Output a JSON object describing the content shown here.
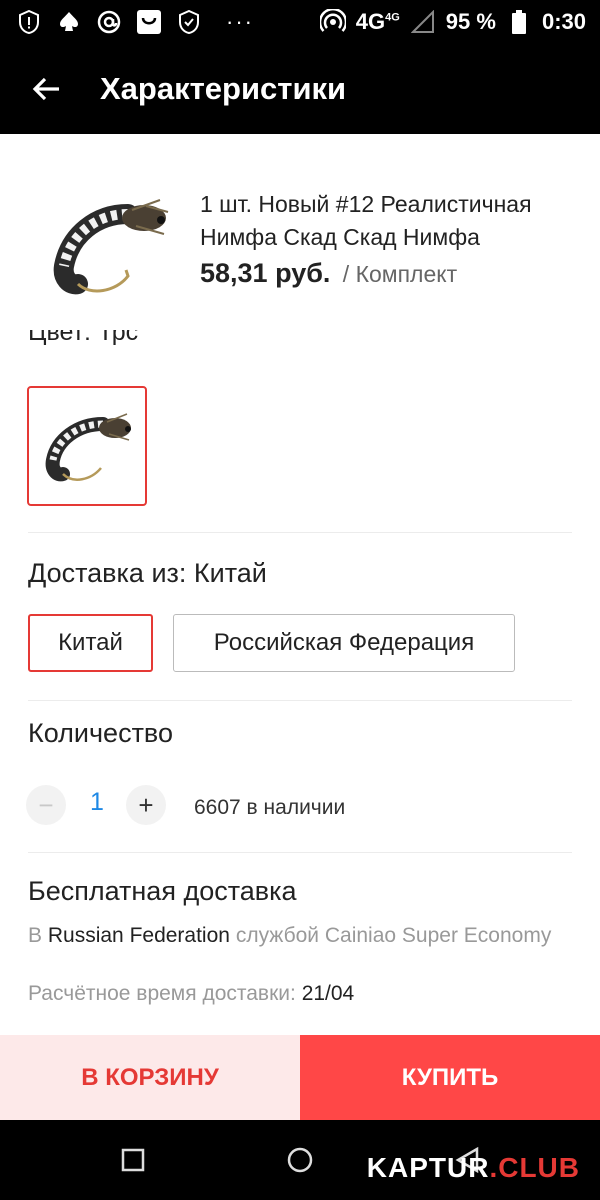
{
  "status_bar": {
    "network": "4G",
    "network_sup": "4G",
    "battery": "95 %",
    "time": "0:30",
    "more": "···"
  },
  "app_bar": {
    "title": "Характеристики"
  },
  "product": {
    "title": "1 шт. Новый #12 Реалистичная Нимфа Скад Скад Нимфа",
    "price": "58,31 руб.",
    "unit": "/ Комплект"
  },
  "color": {
    "label": "Цвет: Трс"
  },
  "delivery_from": {
    "title": "Доставка из: Китай",
    "options": [
      "Китай",
      "Российская Федерация"
    ],
    "selected": "Китай"
  },
  "quantity": {
    "title": "Количество",
    "value": "1",
    "minus": "−",
    "plus": "+",
    "stock": "6607 в наличии"
  },
  "shipping": {
    "title": "Бесплатная доставка",
    "prefix": "В",
    "country": "Russian Federation",
    "service": "службой Cainiao Super Economy",
    "eta_label": "Расчётное время доставки:",
    "eta_value": "21/04"
  },
  "actions": {
    "cart": "В КОРЗИНУ",
    "buy": "КУПИТЬ"
  },
  "watermark": {
    "part1": "KAPTUR",
    "part2": ".CLUB"
  },
  "colors": {
    "accent": "#ff4747",
    "selected_border": "#e53935",
    "cart_bg": "#fde9e9",
    "qty_blue": "#1e88e5"
  }
}
